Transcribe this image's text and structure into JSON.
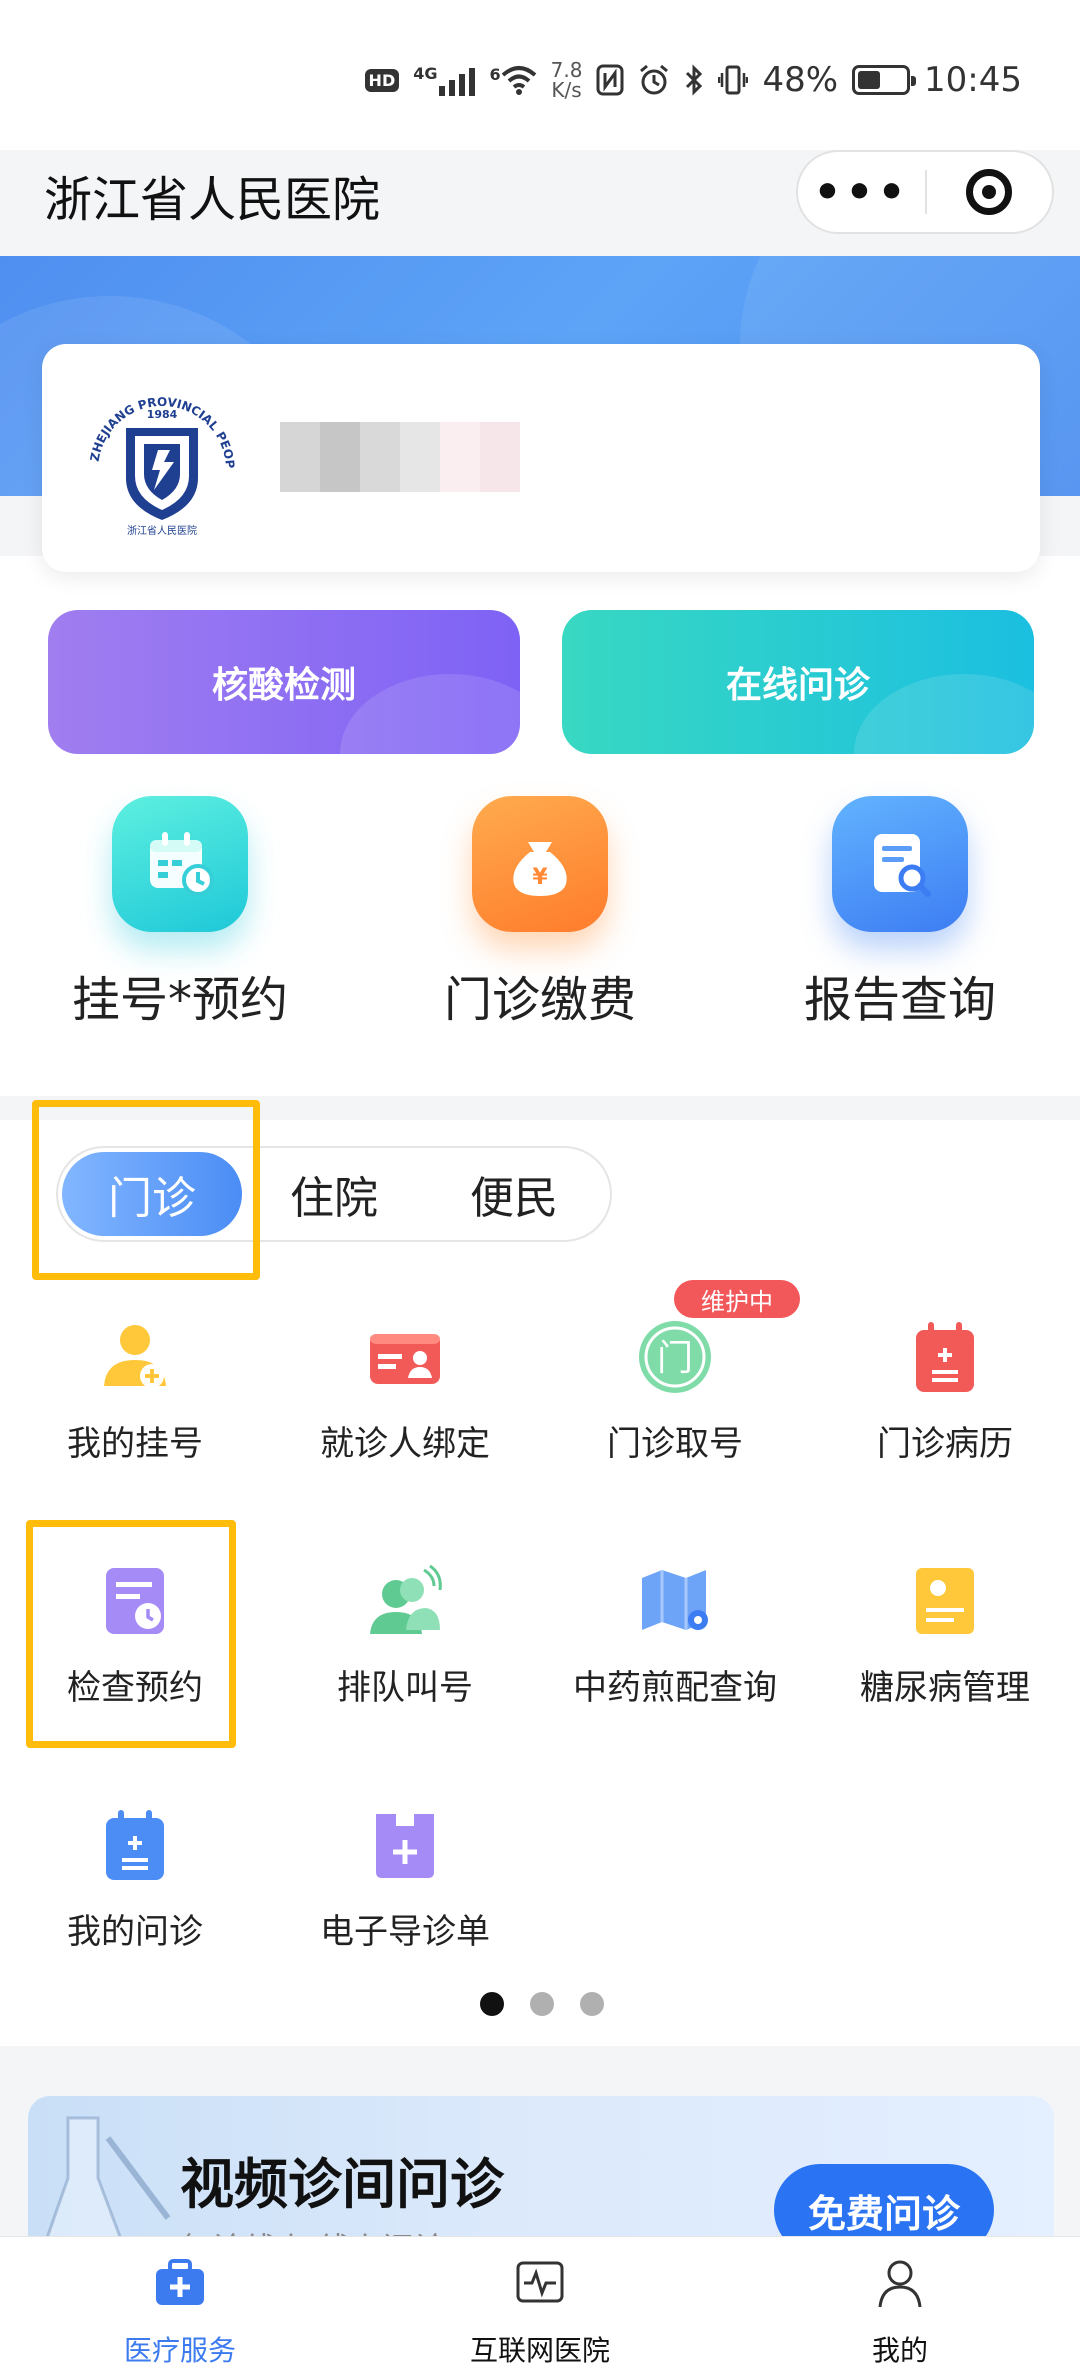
{
  "status_bar": {
    "hd": "HD",
    "network": "4G",
    "wifi_gen": "6",
    "speed_value": "7.8",
    "speed_unit": "K/s",
    "battery": "48%",
    "battery_level": 0.48,
    "time": "10:45"
  },
  "header": {
    "title": "浙江省人民医院",
    "more_icon": "more-dots-icon",
    "close_icon": "target-circle-icon"
  },
  "hospital_card": {
    "logo_year": "1984",
    "logo_arc_text": "ZHEJIANG PROVINCIAL PEOPLE'S",
    "logo_bottom_text": "浙江省人民医院"
  },
  "action_buttons": [
    {
      "label": "核酸检测",
      "color": "#8a6ef3"
    },
    {
      "label": "在线问诊",
      "color": "#26c9d6"
    }
  ],
  "quick_entries": [
    {
      "label": "挂号*预约",
      "icon": "calendar-clock-icon"
    },
    {
      "label": "门诊缴费",
      "icon": "money-bag-icon"
    },
    {
      "label": "报告查询",
      "icon": "report-search-icon"
    }
  ],
  "service_tabs": [
    "门诊",
    "住院",
    "便民"
  ],
  "active_tab": "门诊",
  "maintenance_badge": "维护中",
  "services": [
    {
      "label": "我的挂号",
      "icon": "person-add-icon"
    },
    {
      "label": "就诊人绑定",
      "icon": "id-card-icon"
    },
    {
      "label": "门诊取号",
      "icon": "door-number-icon",
      "text": "门"
    },
    {
      "label": "门诊病历",
      "icon": "clipboard-icon"
    },
    {
      "label": "检查预约",
      "icon": "schedule-icon"
    },
    {
      "label": "排队叫号",
      "icon": "queue-call-icon"
    },
    {
      "label": "中药煎配查询",
      "icon": "map-pin-icon"
    },
    {
      "label": "糖尿病管理",
      "icon": "note-icon"
    },
    {
      "label": "我的问诊",
      "icon": "consult-clipboard-icon"
    },
    {
      "label": "电子导诊单",
      "icon": "guide-form-icon"
    }
  ],
  "page_dots": {
    "count": 3,
    "active": 1
  },
  "promo": {
    "title": "视频诊间问诊",
    "subtitle": "复诊线上 线上问诊",
    "button": "免费问诊"
  },
  "bottom_nav": [
    {
      "label": "医疗服务",
      "icon": "medical-kit-icon",
      "active": true
    },
    {
      "label": "互联网医院",
      "icon": "monitor-pulse-icon",
      "active": false
    },
    {
      "label": "我的",
      "icon": "user-icon",
      "active": false
    }
  ],
  "colors": {
    "primary": "#3b7bef",
    "highlight": "#ffbc0a",
    "badge": "#f2575a"
  }
}
